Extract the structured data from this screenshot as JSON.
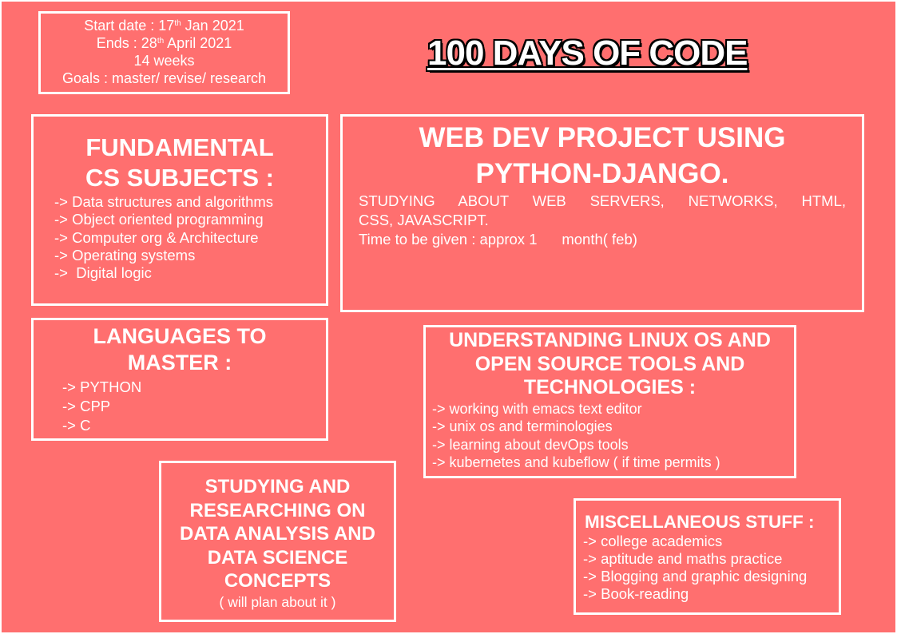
{
  "info": {
    "start_prefix": "Start date : 17",
    "start_sup": "th",
    "start_suffix": " Jan 2021",
    "ends_prefix": "Ends : 28",
    "ends_sup": "th",
    "ends_suffix": " April 2021",
    "weeks": "14 weeks",
    "goals": "Goals : master/ revise/ research"
  },
  "title": "100 DAYS OF CODE",
  "fundamentals": {
    "heading_line1": "FUNDAMENTAL",
    "heading_line2": "CS SUBJECTS :",
    "items": [
      "-> Data structures and algorithms",
      "-> Object oriented programming",
      "-> Computer org & Architecture",
      "-> Operating systems",
      "->  Digital logic"
    ]
  },
  "webdev": {
    "heading_line1": "WEB DEV PROJECT USING",
    "heading_line2": "PYTHON-DJANGO.",
    "text_line1": "STUDYING ABOUT WEB SERVERS, NETWORKS, HTML,",
    "text_line2": "CSS, JAVASCRIPT.",
    "time_line": "Time to be given : approx 1      month( feb)"
  },
  "languages": {
    "heading_line1": "LANGUAGES TO",
    "heading_line2": "MASTER :",
    "items": [
      "-> PYTHON",
      "-> CPP",
      "-> C"
    ]
  },
  "linux": {
    "heading_line1": "UNDERSTANDING LINUX OS AND",
    "heading_line2": "OPEN SOURCE TOOLS AND",
    "heading_line3": "TECHNOLOGIES :",
    "items": [
      "-> working with emacs text editor",
      "-> unix os and terminologies",
      "-> learning about devOps tools",
      "-> kubernetes and kubeflow ( if time permits )"
    ]
  },
  "data_science": {
    "heading_lines": [
      "STUDYING AND",
      "RESEARCHING ON",
      "DATA ANALYSIS AND",
      "DATA SCIENCE",
      "CONCEPTS"
    ],
    "note": "( will plan about it )"
  },
  "misc": {
    "heading": "MISCELLANEOUS STUFF :",
    "items": [
      "-> college academics",
      "-> aptitude and maths practice",
      "-> Blogging and graphic designing",
      "-> Book-reading"
    ]
  },
  "colors": {
    "background": "#ff6f6f",
    "border": "#ffffff",
    "text": "#ffffff"
  }
}
